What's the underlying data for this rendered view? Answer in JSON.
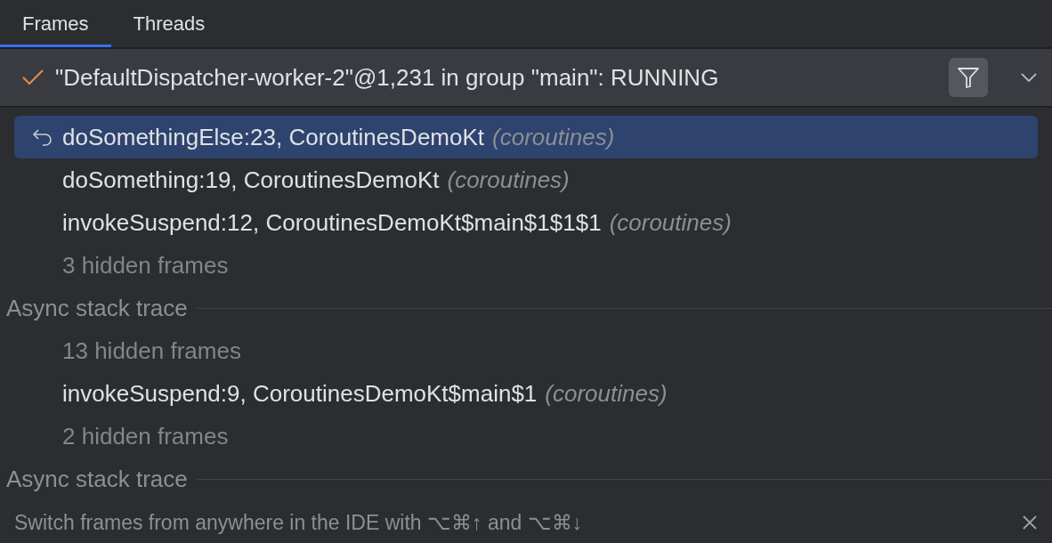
{
  "tabs": [
    {
      "label": "Frames",
      "selected": true
    },
    {
      "label": "Threads",
      "selected": false
    }
  ],
  "thread": {
    "label": "\"DefaultDispatcher-worker-2\"@1,231 in group \"main\": RUNNING",
    "filter_on": true
  },
  "frames": [
    {
      "kind": "frame",
      "method": "doSomethingElse:23, CoroutinesDemoKt",
      "package": "(coroutines)",
      "selected": true
    },
    {
      "kind": "frame",
      "method": "doSomething:19, CoroutinesDemoKt",
      "package": "(coroutines)",
      "selected": false
    },
    {
      "kind": "frame",
      "method": "invokeSuspend:12, CoroutinesDemoKt$main$1$1$1",
      "package": "(coroutines)",
      "selected": false
    },
    {
      "kind": "hidden",
      "label": "3 hidden frames"
    },
    {
      "kind": "separator",
      "label": "Async stack trace"
    },
    {
      "kind": "hidden",
      "label": "13 hidden frames"
    },
    {
      "kind": "frame",
      "method": "invokeSuspend:9, CoroutinesDemoKt$main$1",
      "package": "(coroutines)",
      "selected": false
    },
    {
      "kind": "hidden",
      "label": "2 hidden frames"
    },
    {
      "kind": "separator",
      "label": "Async stack trace"
    }
  ],
  "hint": "Switch frames from anywhere in the IDE with ⌥⌘↑ and ⌥⌘↓"
}
